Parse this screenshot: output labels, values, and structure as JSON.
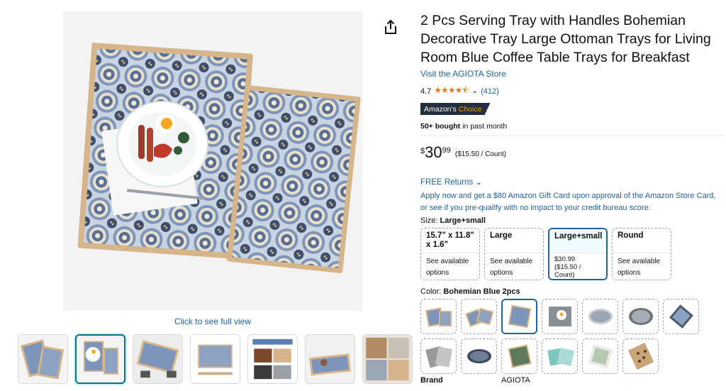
{
  "gallery": {
    "full_view_link": "Click to see full view",
    "thumbnails": [
      {
        "alt": "two trays stacked"
      },
      {
        "alt": "trays with breakfast plate"
      },
      {
        "alt": "tray carried by hands"
      },
      {
        "alt": "tray dimensions"
      },
      {
        "alt": "tray features"
      },
      {
        "alt": "tray on table"
      },
      {
        "alt": "room scenes"
      }
    ],
    "selected_thumbnail": 2
  },
  "product": {
    "title": "2 Pcs Serving Tray with Handles Bohemian Decorative Tray Large Ottoman Trays for Living Room Blue Coffee Table Trays for Breakfast",
    "store_link": "Visit the AGIOTA Store",
    "rating": "4.7",
    "review_count": "(412)",
    "badge_prefix": "Amazon's",
    "badge_choice": "Choice",
    "bought_bold": "50+ bought",
    "bought_rest": " in past month",
    "price": {
      "currency": "$",
      "whole": "30",
      "fraction": "99",
      "per_unit": "($15.50 / Count)"
    },
    "returns_link": "FREE Returns",
    "promo": "Apply now and get a $80 Amazon Gift Card upon approval of the Amazon Store Card, or see if you pre-qualify with no impact to your credit bureau score."
  },
  "size": {
    "label": "Size: ",
    "selected": "Large+small",
    "options": [
      {
        "name": "15.7\" x 11.8\" x 1.6\"",
        "sub": "See available options"
      },
      {
        "name": "Large",
        "sub": "See available options"
      },
      {
        "name": "Large+small",
        "price": "$30.99",
        "unit": "($15.50 / Count)"
      },
      {
        "name": "Round",
        "sub": "See available options"
      }
    ]
  },
  "color": {
    "label": "Color: ",
    "selected": "Bohemian Blue 2pcs",
    "swatches": [
      "blue-pair",
      "blue-pair-2",
      "blue-single",
      "grey-breakfast",
      "oval-blue",
      "round-grey",
      "blue-angled",
      "grey-pair",
      "oval-navy",
      "green-pattern",
      "teal-pair",
      "white-green",
      "leopard"
    ],
    "selected_index": 2
  },
  "specs": [
    {
      "key": "Brand",
      "value": "AGIOTA"
    }
  ],
  "colors": {
    "link": "#2162a1",
    "star": "#de7921",
    "badge_bg": "#232f3e",
    "badge_accent": "#ff9900",
    "selected_border": "#2162a1"
  }
}
